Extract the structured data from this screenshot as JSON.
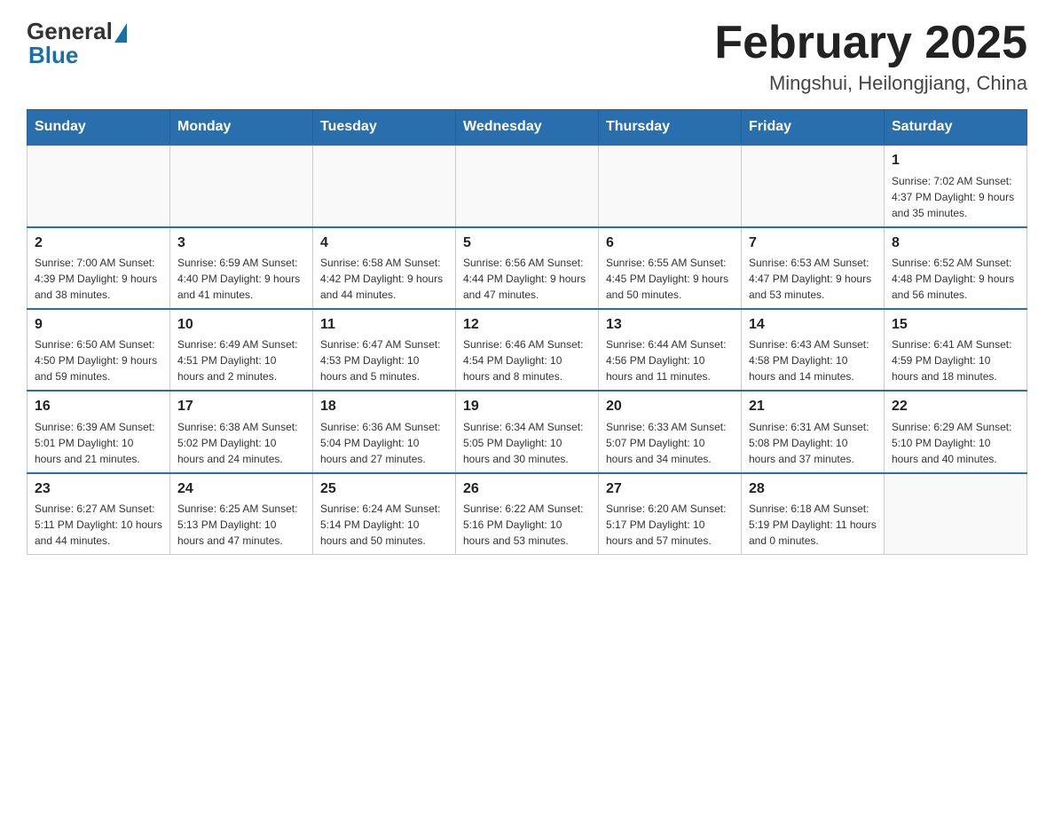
{
  "header": {
    "logo_general": "General",
    "logo_blue": "Blue",
    "month_title": "February 2025",
    "location": "Mingshui, Heilongjiang, China"
  },
  "weekdays": [
    "Sunday",
    "Monday",
    "Tuesday",
    "Wednesday",
    "Thursday",
    "Friday",
    "Saturday"
  ],
  "weeks": [
    [
      {
        "day": "",
        "info": ""
      },
      {
        "day": "",
        "info": ""
      },
      {
        "day": "",
        "info": ""
      },
      {
        "day": "",
        "info": ""
      },
      {
        "day": "",
        "info": ""
      },
      {
        "day": "",
        "info": ""
      },
      {
        "day": "1",
        "info": "Sunrise: 7:02 AM\nSunset: 4:37 PM\nDaylight: 9 hours and 35 minutes."
      }
    ],
    [
      {
        "day": "2",
        "info": "Sunrise: 7:00 AM\nSunset: 4:39 PM\nDaylight: 9 hours and 38 minutes."
      },
      {
        "day": "3",
        "info": "Sunrise: 6:59 AM\nSunset: 4:40 PM\nDaylight: 9 hours and 41 minutes."
      },
      {
        "day": "4",
        "info": "Sunrise: 6:58 AM\nSunset: 4:42 PM\nDaylight: 9 hours and 44 minutes."
      },
      {
        "day": "5",
        "info": "Sunrise: 6:56 AM\nSunset: 4:44 PM\nDaylight: 9 hours and 47 minutes."
      },
      {
        "day": "6",
        "info": "Sunrise: 6:55 AM\nSunset: 4:45 PM\nDaylight: 9 hours and 50 minutes."
      },
      {
        "day": "7",
        "info": "Sunrise: 6:53 AM\nSunset: 4:47 PM\nDaylight: 9 hours and 53 minutes."
      },
      {
        "day": "8",
        "info": "Sunrise: 6:52 AM\nSunset: 4:48 PM\nDaylight: 9 hours and 56 minutes."
      }
    ],
    [
      {
        "day": "9",
        "info": "Sunrise: 6:50 AM\nSunset: 4:50 PM\nDaylight: 9 hours and 59 minutes."
      },
      {
        "day": "10",
        "info": "Sunrise: 6:49 AM\nSunset: 4:51 PM\nDaylight: 10 hours and 2 minutes."
      },
      {
        "day": "11",
        "info": "Sunrise: 6:47 AM\nSunset: 4:53 PM\nDaylight: 10 hours and 5 minutes."
      },
      {
        "day": "12",
        "info": "Sunrise: 6:46 AM\nSunset: 4:54 PM\nDaylight: 10 hours and 8 minutes."
      },
      {
        "day": "13",
        "info": "Sunrise: 6:44 AM\nSunset: 4:56 PM\nDaylight: 10 hours and 11 minutes."
      },
      {
        "day": "14",
        "info": "Sunrise: 6:43 AM\nSunset: 4:58 PM\nDaylight: 10 hours and 14 minutes."
      },
      {
        "day": "15",
        "info": "Sunrise: 6:41 AM\nSunset: 4:59 PM\nDaylight: 10 hours and 18 minutes."
      }
    ],
    [
      {
        "day": "16",
        "info": "Sunrise: 6:39 AM\nSunset: 5:01 PM\nDaylight: 10 hours and 21 minutes."
      },
      {
        "day": "17",
        "info": "Sunrise: 6:38 AM\nSunset: 5:02 PM\nDaylight: 10 hours and 24 minutes."
      },
      {
        "day": "18",
        "info": "Sunrise: 6:36 AM\nSunset: 5:04 PM\nDaylight: 10 hours and 27 minutes."
      },
      {
        "day": "19",
        "info": "Sunrise: 6:34 AM\nSunset: 5:05 PM\nDaylight: 10 hours and 30 minutes."
      },
      {
        "day": "20",
        "info": "Sunrise: 6:33 AM\nSunset: 5:07 PM\nDaylight: 10 hours and 34 minutes."
      },
      {
        "day": "21",
        "info": "Sunrise: 6:31 AM\nSunset: 5:08 PM\nDaylight: 10 hours and 37 minutes."
      },
      {
        "day": "22",
        "info": "Sunrise: 6:29 AM\nSunset: 5:10 PM\nDaylight: 10 hours and 40 minutes."
      }
    ],
    [
      {
        "day": "23",
        "info": "Sunrise: 6:27 AM\nSunset: 5:11 PM\nDaylight: 10 hours and 44 minutes."
      },
      {
        "day": "24",
        "info": "Sunrise: 6:25 AM\nSunset: 5:13 PM\nDaylight: 10 hours and 47 minutes."
      },
      {
        "day": "25",
        "info": "Sunrise: 6:24 AM\nSunset: 5:14 PM\nDaylight: 10 hours and 50 minutes."
      },
      {
        "day": "26",
        "info": "Sunrise: 6:22 AM\nSunset: 5:16 PM\nDaylight: 10 hours and 53 minutes."
      },
      {
        "day": "27",
        "info": "Sunrise: 6:20 AM\nSunset: 5:17 PM\nDaylight: 10 hours and 57 minutes."
      },
      {
        "day": "28",
        "info": "Sunrise: 6:18 AM\nSunset: 5:19 PM\nDaylight: 11 hours and 0 minutes."
      },
      {
        "day": "",
        "info": ""
      }
    ]
  ]
}
